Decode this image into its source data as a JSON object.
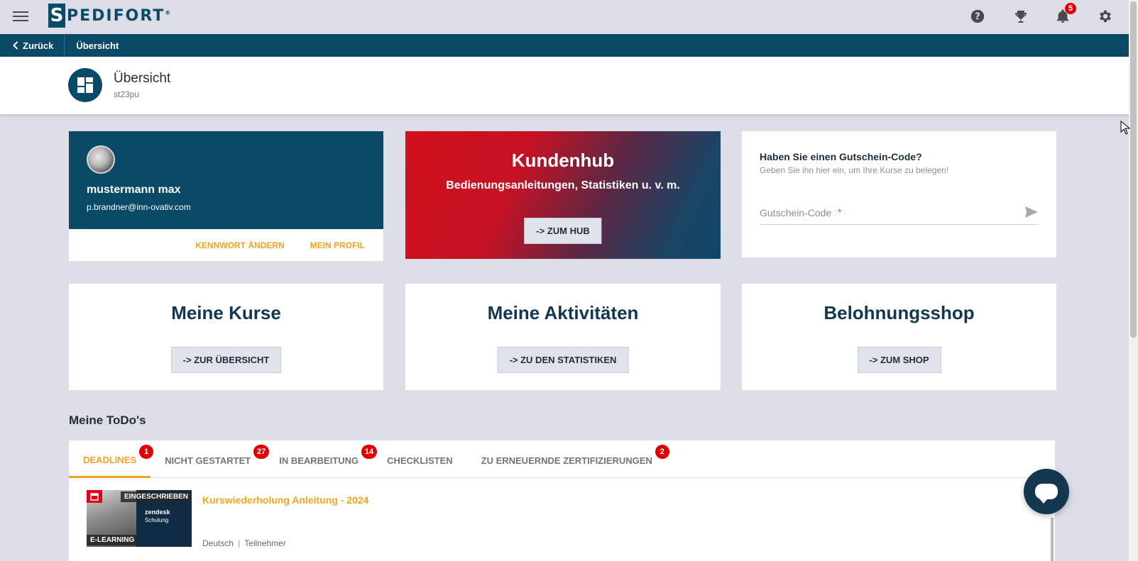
{
  "brand": {
    "logo_letter": "S",
    "logo_rest": "PEDIFORT",
    "logo_reg": "®",
    "color": "#0b4a66"
  },
  "topbar": {
    "icons": [
      "menu-icon",
      "help-icon",
      "trophy-icon",
      "bell-icon",
      "gear-icon"
    ],
    "notification_count": "5"
  },
  "navbar": {
    "back_label": "Zurück",
    "breadcrumb": "Übersicht"
  },
  "header": {
    "title": "Übersicht",
    "subtitle": "st23pu",
    "icon": "dashboard-icon"
  },
  "profile": {
    "name": "mustermann max",
    "email": "p.brandner@inn-ovativ.com",
    "change_password": "Kennwort ändern",
    "my_profile": "Mein Profil"
  },
  "hub": {
    "title": "Kundenhub",
    "subtitle": "Bedienungsanleitungen, Statistiken u. v. m.",
    "button": "-> Zum Hub"
  },
  "voucher": {
    "title": "Haben Sie einen Gutschein-Code?",
    "subtitle": "Geben Sie ihn hier ein, um Ihre Kurse zu belegen!",
    "placeholder": "Gutschein-Code",
    "required_mark": "*"
  },
  "features": [
    {
      "title": "Meine Kurse",
      "button": "-> Zur Übersicht"
    },
    {
      "title": "Meine Aktivitäten",
      "button": "-> Zu den Statistiken"
    },
    {
      "title": "Belohnungsshop",
      "button": "-> Zum Shop"
    }
  ],
  "todos": {
    "heading": "Meine ToDo's",
    "tabs": [
      {
        "label": "Deadlines",
        "badge": "1",
        "active": true
      },
      {
        "label": "Nicht gestartet",
        "badge": "27"
      },
      {
        "label": "In Bearbeitung",
        "badge": "14"
      },
      {
        "label": "Checklisten",
        "badge": ""
      },
      {
        "label": "Zu erneuernde Zertifizierungen",
        "badge": "2"
      }
    ],
    "course": {
      "title": "Kurswiederholung Anleitung - 2024",
      "status": "Eingeschrieben",
      "type": "E-Learning",
      "brand": "zendesk",
      "brand_sub": "Schulung",
      "language": "Deutsch",
      "role": "Teilnehmer"
    }
  },
  "colors": {
    "accent": "#f0a51f",
    "primary": "#0b4a66",
    "badge": "#e00000"
  }
}
